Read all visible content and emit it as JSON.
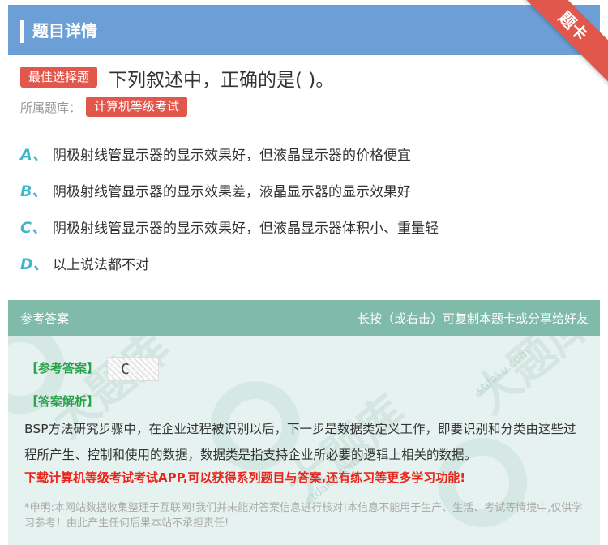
{
  "header": {
    "title": "题目详情",
    "ribbon": "题卡"
  },
  "question": {
    "type_tag": "最佳选择题",
    "text": "下列叙述中，正确的是( )。",
    "bank_label": "所属题库：",
    "bank_tag": "计算机等级考试"
  },
  "options": [
    {
      "letter": "A、",
      "text": "阴极射线管显示器的显示效果好，但液晶显示器的价格便宜"
    },
    {
      "letter": "B、",
      "text": "阴极射线管显示器的显示效果差，液晶显示器的显示效果好"
    },
    {
      "letter": "C、",
      "text": "阴极射线管显示器的显示效果好，但液晶显示器体积小、重量轻"
    },
    {
      "letter": "D、",
      "text": "以上说法都不对"
    }
  ],
  "answer": {
    "head_left": "参考答案",
    "head_right": "长按（或右击）可复制本题卡或分享给好友",
    "ref_label": "【参考答案】",
    "ref_value": "C",
    "analysis_label": "【答案解析】",
    "analysis_text": "BSP方法研究步骤中，在企业过程被识别以后，下一步是数据类定义工作，即要识别和分类由这些过程所产生、控制和使用的数据，数据类是指支持企业所必要的逻辑上相关的数据。",
    "promo": "下载计算机等级考试考试APP,可以获得系列题目与答案,还有练习等更多学习功能!",
    "disclaimer": "*申明:本网站数据收集整理于互联网!我们并未能对答案信息进行核对!本信息不能用于生产、生活、考试等情境中,仅供学习参考！由此产生任何后果本站不承担责任!"
  },
  "watermark": {
    "text": "大题库",
    "site": "stdaku.com"
  },
  "colors": {
    "header": "#6c9fd6",
    "tag": "#e2574c",
    "option_letter": "#3fb8c9",
    "answer_head": "#7fbba8",
    "answer_label": "#2aa14b",
    "promo": "#e8261c"
  }
}
